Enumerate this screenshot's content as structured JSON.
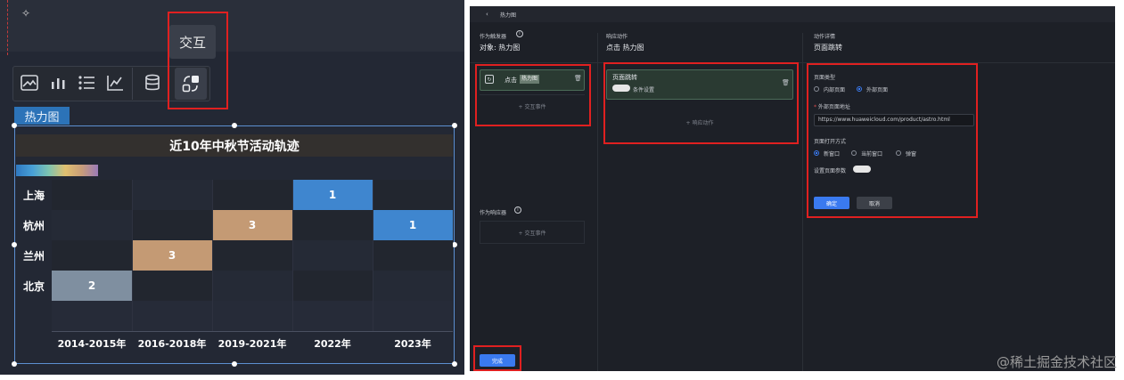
{
  "left": {
    "tooltip": "交互",
    "toolbar_icons": [
      "image-chart-icon",
      "bar-chart-icon",
      "list-icon",
      "line-chart-icon",
      "database-icon",
      "interaction-icon"
    ],
    "component_tag": "热力图",
    "colors": {
      "blue": "#3f86cf",
      "tan": "#c49a74",
      "grey": "#7f8fa0",
      "empty": "#262b38"
    }
  },
  "chart_data": {
    "type": "heatmap",
    "title": "近10年中秋节活动轨迹",
    "x_categories": [
      "2014-2015年",
      "2016-2018年",
      "2019-2021年",
      "2022年",
      "2023年"
    ],
    "y_categories": [
      "上海",
      "杭州",
      "兰州",
      "北京"
    ],
    "cells": [
      {
        "y": "上海",
        "x": "2022年",
        "value": 1,
        "color": "#3f86cf"
      },
      {
        "y": "杭州",
        "x": "2019-2021年",
        "value": 3,
        "color": "#c49a74"
      },
      {
        "y": "杭州",
        "x": "2023年",
        "value": 1,
        "color": "#3f86cf"
      },
      {
        "y": "兰州",
        "x": "2016-2018年",
        "value": 3,
        "color": "#c49a74"
      },
      {
        "y": "北京",
        "x": "2014-2015年",
        "value": 2,
        "color": "#7f8fa0"
      }
    ]
  },
  "right": {
    "header_title": "热力图",
    "trigger": {
      "section_label": "作为触发器",
      "object_label": "对象: 热力图",
      "event_label": "点击",
      "event_badge": "热力图",
      "add_event": "+ 交互事件",
      "receiver_label": "作为响应器",
      "add_event2": "+ 交互事件",
      "done_button": "完成"
    },
    "response": {
      "section_label": "响应动作",
      "title": "点击 热力图",
      "action_name": "页面跳转",
      "condition_label": "条件设置",
      "add_action": "+ 响应动作"
    },
    "detail": {
      "section_label": "动作详情",
      "title": "页面跳转",
      "page_type_label": "页面类型",
      "page_type_options": [
        "内部页面",
        "外部页面"
      ],
      "page_type_selected": "外部页面",
      "url_label": "外部页面地址",
      "url_value": "https://www.huaweicloud.com/product/astro.html",
      "open_mode_label": "页面打开方式",
      "open_mode_options": [
        "新窗口",
        "当前窗口",
        "弹窗"
      ],
      "open_mode_selected": "新窗口",
      "param_label": "设置页面参数",
      "confirm": "确定",
      "cancel": "取消"
    }
  },
  "watermark": "@稀土掘金技术社区"
}
